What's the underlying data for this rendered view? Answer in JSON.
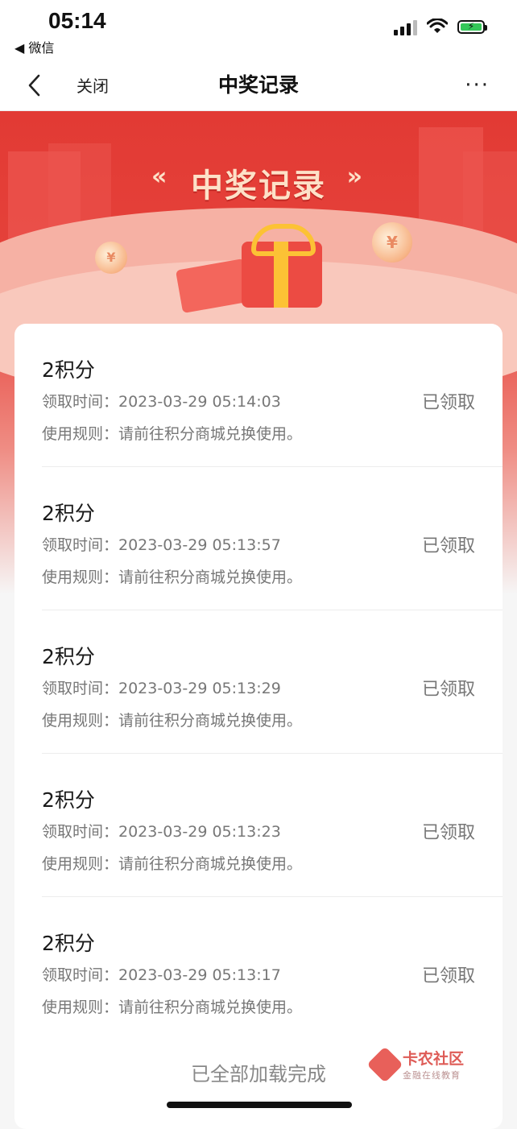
{
  "status_bar": {
    "time": "05:14",
    "back_app": "◀ 微信"
  },
  "nav": {
    "close_label": "关闭",
    "title": "中奖记录",
    "more": "···"
  },
  "banner": {
    "title": "中奖记录",
    "deco_left": "«",
    "deco_right": "»",
    "coin_symbol": "¥"
  },
  "records": [
    {
      "points": "2积分",
      "time": "领取时间：2023-03-29 05:14:03",
      "rule": "使用规则：请前往积分商城兑换使用。",
      "status": "已领取"
    },
    {
      "points": "2积分",
      "time": "领取时间：2023-03-29 05:13:57",
      "rule": "使用规则：请前往积分商城兑换使用。",
      "status": "已领取"
    },
    {
      "points": "2积分",
      "time": "领取时间：2023-03-29 05:13:29",
      "rule": "使用规则：请前往积分商城兑换使用。",
      "status": "已领取"
    },
    {
      "points": "2积分",
      "time": "领取时间：2023-03-29 05:13:23",
      "rule": "使用规则：请前往积分商城兑换使用。",
      "status": "已领取"
    },
    {
      "points": "2积分",
      "time": "领取时间：2023-03-29 05:13:17",
      "rule": "使用规则：请前往积分商城兑换使用。",
      "status": "已领取"
    }
  ],
  "footer": {
    "done_text": "已全部加载完成"
  },
  "watermark": {
    "main": "卡农社区",
    "sub": "金融在线教育"
  },
  "colors": {
    "brand_red": "#e23a34",
    "gold": "#fcc235",
    "battery_green": "#34c759"
  }
}
